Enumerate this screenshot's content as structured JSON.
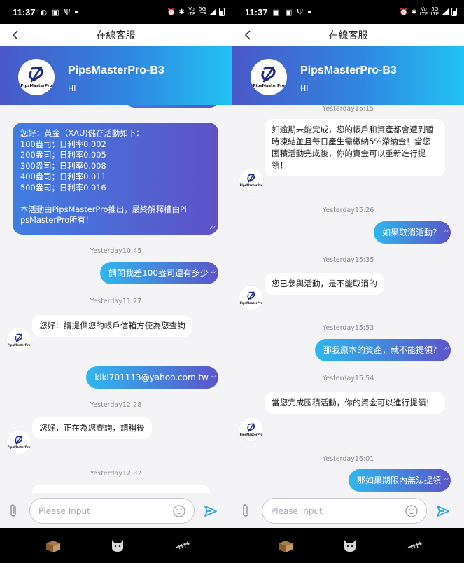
{
  "status_bar": {
    "time": "11:37"
  },
  "nav": {
    "title": "在線客服"
  },
  "header": {
    "name": "PipsMasterPro-B3",
    "subtitle": "HI",
    "logo_text": "PipsMasterPro"
  },
  "input": {
    "placeholder": "Please Input"
  },
  "colors": {
    "header_gradient_start": "#4a58c8",
    "header_gradient_end": "#22c2f4",
    "user_bubble_start": "#2fb7ef",
    "user_bubble_end": "#5b55c9",
    "send_icon": "#2ba7e8"
  },
  "icons": {
    "back": "chevron-left-icon",
    "attach": "paperclip-icon",
    "emoji": "smiley-icon",
    "send": "send-icon"
  },
  "left_chat": {
    "promo_lines": [
      "您好：黃金（XAU)儲存活動如下：",
      "100盎司；日利率0.002",
      "200盎司；日利率0.005",
      "300盎司；日利率0.008",
      "400盎司；日利率0.011",
      "500盎司；日利率0.016",
      "",
      "本活動由PipsMasterPro推出，最終解釋權由Pi",
      "psMasterPro所有！"
    ],
    "ts1": "Yesterday10:45",
    "msg_user1": "請問我差100盎司還有多少",
    "ts2": "Yesterday11:27",
    "msg_bot1": "您好：請提供您的帳戶信箱方便為您查詢",
    "msg_user2": "kiki701113@yahoo.com.tw",
    "ts3": "Yesterday12:28",
    "msg_bot2": "您好，正在為您查詢，請稍後",
    "ts4": "Yesterday12:32"
  },
  "right_chat": {
    "ts0": "Yesterday15:15",
    "msg_bot1": "如逾期未能完成，您的帳戶和資產都會遭到暫時凍結並且每日產生需繳納5%滯納金！當您囤積活動完成後，你的資金可以重新進行提領！",
    "ts1": "Yesterday15:26",
    "msg_user1": "如果取消活動？",
    "ts2": "Yesterday15:35",
    "msg_bot2": "您已參與活動，是不能取消的",
    "ts3": "Yesterday15:53",
    "msg_user2": "那我原本的資產，就不能提領？",
    "ts4": "Yesterday15:54",
    "msg_bot3": "當您完成囤積活動，你的資金可以進行提領！",
    "ts5": "Yesterday16:01",
    "msg_user3": "那如果期限內無法提領"
  }
}
